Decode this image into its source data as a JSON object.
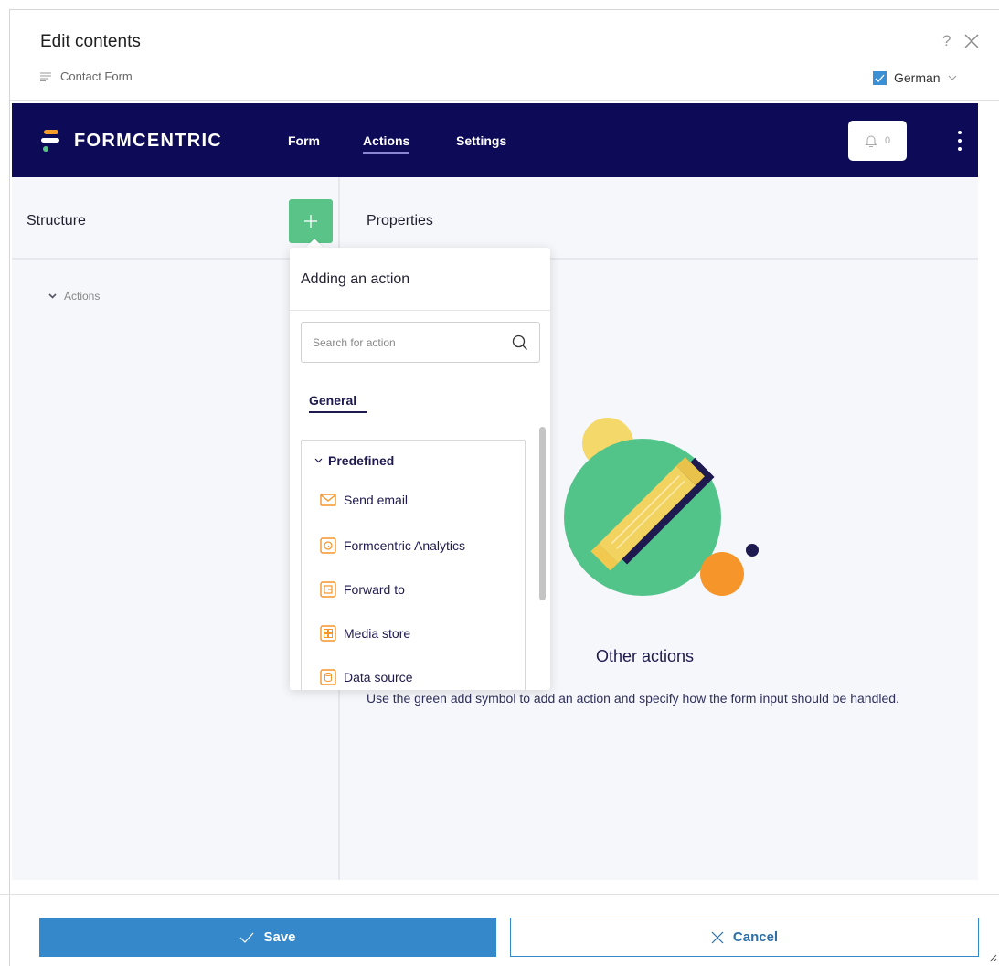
{
  "dialog": {
    "title": "Edit contents",
    "help": "?",
    "subtitle": "Contact Form",
    "language": "German",
    "language_checked": true
  },
  "app": {
    "logo_text": "FORMCENTRIC",
    "nav": [
      {
        "label": "Form",
        "active": false
      },
      {
        "label": "Actions",
        "active": true
      },
      {
        "label": "Settings",
        "active": false
      }
    ],
    "notification_count": "0",
    "colors": {
      "navbar": "#0d0a57",
      "accent_green": "#5ac488",
      "primary_blue": "#3588c9"
    }
  },
  "structure": {
    "title": "Structure",
    "tree_item": "Actions"
  },
  "properties": {
    "title": "Properties",
    "empty_title": "Other actions",
    "empty_desc": "Use the green add symbol to add an action and specify how the form input should be handled."
  },
  "popover": {
    "title": "Adding an action",
    "search_placeholder": "Search for action",
    "tab": "General",
    "group": "Predefined",
    "items": [
      {
        "label": "Send email",
        "icon": "envelope-icon"
      },
      {
        "label": "Formcentric Analytics",
        "icon": "analytics-icon"
      },
      {
        "label": "Forward to",
        "icon": "forward-icon"
      },
      {
        "label": "Media store",
        "icon": "media-store-icon"
      },
      {
        "label": "Data source",
        "icon": "database-icon"
      }
    ]
  },
  "footer": {
    "save_label": "Save",
    "cancel_label": "Cancel"
  }
}
